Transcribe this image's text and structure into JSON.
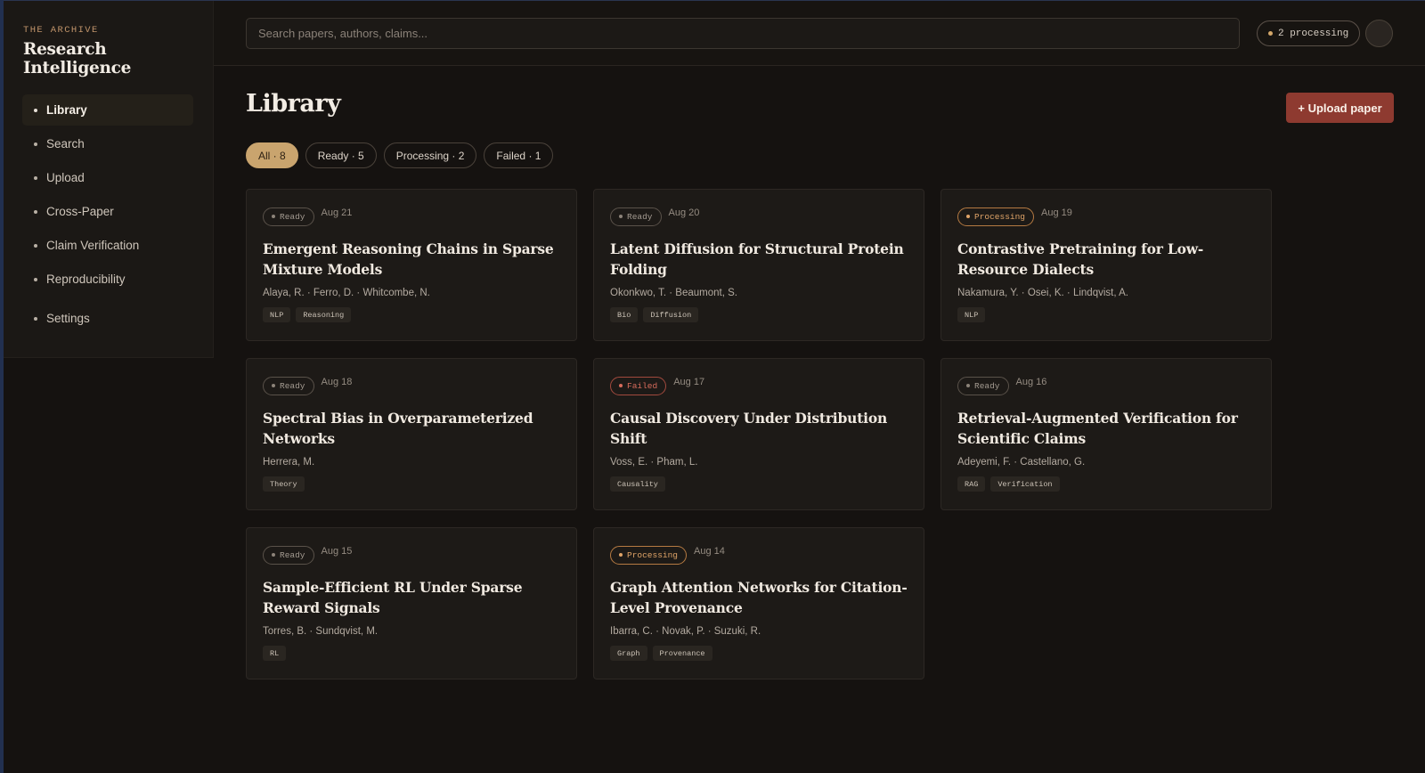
{
  "brand": {
    "kicker": "THE ARCHIVE",
    "title": "Research Intelligence"
  },
  "nav": [
    {
      "label": "Library",
      "active": true
    },
    {
      "label": "Search"
    },
    {
      "label": "Upload"
    },
    {
      "label": "Cross-Paper"
    },
    {
      "label": "Claim Verification"
    },
    {
      "label": "Reproducibility"
    },
    {
      "label": "Settings"
    }
  ],
  "search": {
    "placeholder": "Search papers, authors, claims...",
    "value": ""
  },
  "topbar": {
    "processing_label": "2 processing"
  },
  "page": {
    "title": "Library",
    "upload_label": "+ Upload paper"
  },
  "filters": [
    {
      "label": "All · 8",
      "active": true
    },
    {
      "label": "Ready · 5"
    },
    {
      "label": "Processing · 2"
    },
    {
      "label": "Failed · 1"
    }
  ],
  "papers": [
    {
      "status": "Ready",
      "date": "Aug 21",
      "title": "Emergent Reasoning Chains in Sparse Mixture Models",
      "authors": "Alaya, R. · Ferro, D. · Whitcombe, N.",
      "tags": [
        "NLP",
        "Reasoning"
      ]
    },
    {
      "status": "Ready",
      "date": "Aug 20",
      "title": "Latent Diffusion for Structural Protein Folding",
      "authors": "Okonkwo, T. · Beaumont, S.",
      "tags": [
        "Bio",
        "Diffusion"
      ]
    },
    {
      "status": "Processing",
      "date": "Aug 19",
      "title": "Contrastive Pretraining for Low-Resource Dialects",
      "authors": "Nakamura, Y. · Osei, K. · Lindqvist, A.",
      "tags": [
        "NLP"
      ]
    },
    {
      "status": "Ready",
      "date": "Aug 18",
      "title": "Spectral Bias in Overparameterized Networks",
      "authors": "Herrera, M.",
      "tags": [
        "Theory"
      ]
    },
    {
      "status": "Failed",
      "date": "Aug 17",
      "title": "Causal Discovery Under Distribution Shift",
      "authors": "Voss, E. · Pham, L.",
      "tags": [
        "Causality"
      ]
    },
    {
      "status": "Ready",
      "date": "Aug 16",
      "title": "Retrieval-Augmented Verification for Scientific Claims",
      "authors": "Adeyemi, F. · Castellano, G.",
      "tags": [
        "RAG",
        "Verification"
      ]
    },
    {
      "status": "Ready",
      "date": "Aug 15",
      "title": "Sample-Efficient RL Under Sparse Reward Signals",
      "authors": "Torres, B. · Sundqvist, M.",
      "tags": [
        "RL"
      ]
    },
    {
      "status": "Processing",
      "date": "Aug 14",
      "title": "Graph Attention Networks for Citation-Level Provenance",
      "authors": "Ibarra, C. · Novak, P. · Suzuki, R.",
      "tags": [
        "Graph",
        "Provenance"
      ]
    }
  ]
}
